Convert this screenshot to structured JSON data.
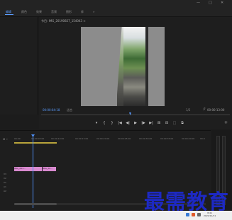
{
  "menu": {
    "items": [
      {
        "label": "编辑"
      },
      {
        "label": "颜色"
      },
      {
        "label": "效果"
      },
      {
        "label": "音频"
      },
      {
        "label": "图形"
      },
      {
        "label": "库"
      },
      {
        "label": "»"
      }
    ]
  },
  "window": {
    "controls": {
      "minimize": "—",
      "maximize": "□",
      "close": "✕"
    }
  },
  "program": {
    "sequence_title": "节目: IMG_20190827_154043 ≡",
    "timecode_current": "00:00:04:18",
    "fit_label": "适合",
    "ratio_label": "1/2",
    "timecode_duration": "00:00:13:00",
    "transport": [
      "▾",
      "{",
      "}",
      "|◀",
      "◀|",
      "▶",
      "|▶",
      "▶|",
      "⊞",
      "⊟",
      "⬚",
      "⧉",
      "+"
    ],
    "accent": "#5a9cff"
  },
  "timeline": {
    "ruler_ticks": [
      "00:00",
      "00:00:05:00",
      "00:00:10:00",
      "00:00:15:00",
      "00:00:20:00",
      "00:00:25:00",
      "00:00:30:00",
      "00:00:35:00",
      "00:00:40:00",
      "00:0"
    ],
    "clips": [
      {
        "label": "IMG_201..."
      },
      {
        "label": "IMG_20..."
      }
    ],
    "track_labels": [
      "V3",
      "V2",
      "V1",
      "A1",
      "A2",
      "A3"
    ],
    "clip_color": "#d98ad0",
    "playhead_color": "#4d8cf0"
  },
  "taskbar": {
    "time": "8:41",
    "date": "2021/11/11"
  },
  "watermark": {
    "text": "最需教育",
    "color": "#1d29c4"
  }
}
